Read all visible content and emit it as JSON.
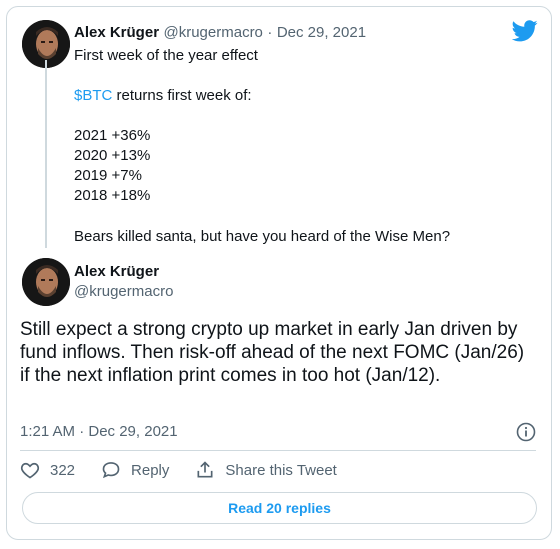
{
  "tweet1": {
    "author_name": "Alex Krüger",
    "handle": "@krugermacro",
    "separator": "·",
    "date": "Dec 29, 2021",
    "line1": "First week of the year effect",
    "cashtag": "$BTC",
    "line2_rest": " returns first week of:",
    "returns": [
      "2021 +36%",
      "2020 +13%",
      "2019 +7%",
      "2018 +18%"
    ],
    "closing": "Bears killed santa, but have you heard of the Wise Men?"
  },
  "tweet2": {
    "author_name": "Alex Krüger",
    "handle": "@krugermacro",
    "body": "Still expect a strong crypto up market in early Jan driven by fund inflows. Then risk-off ahead of the next FOMC (Jan/26) if the next inflation print comes in too hot (Jan/12).",
    "timestamp": "1:21 AM · Dec 29, 2021",
    "like_count": "322",
    "reply_label": "Reply",
    "share_label": "Share this Tweet",
    "read_replies_label": "Read 20 replies"
  },
  "colors": {
    "accent": "#1d9bf0",
    "muted": "#536471",
    "border": "#cfd9de",
    "text": "#0f1419"
  },
  "icons": {
    "brand": "twitter-bird-icon",
    "like": "heart-icon",
    "reply": "speech-bubble-icon",
    "share": "share-arrow-icon",
    "info": "info-icon"
  }
}
